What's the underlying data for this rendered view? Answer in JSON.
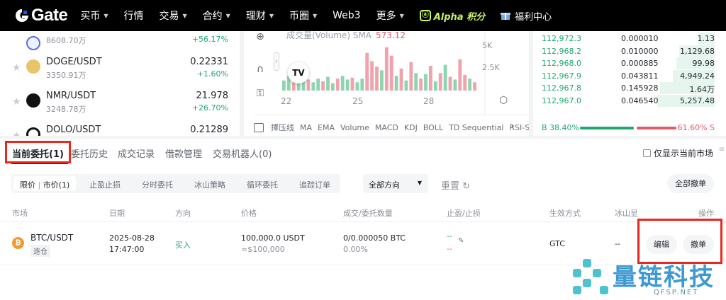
{
  "nav": {
    "logo_text": "Gate",
    "items": [
      {
        "label": "买币",
        "caret": true
      },
      {
        "label": "行情",
        "caret": false
      },
      {
        "label": "交易",
        "caret": true
      },
      {
        "label": "合约",
        "caret": true
      },
      {
        "label": "理财",
        "caret": true
      },
      {
        "label": "币圈",
        "caret": true
      },
      {
        "label": "Web3",
        "caret": false
      },
      {
        "label": "更多",
        "caret": true
      }
    ],
    "alpha_label": "Alpha 积分",
    "welfare_label": "福利中心"
  },
  "markets": [
    {
      "symbol": "",
      "volume": "8608.70万",
      "price": "",
      "change": "+56.17%"
    },
    {
      "symbol": "DOGE/USDT",
      "volume": "3350.91万",
      "price": "0.22331",
      "change": "+1.60%"
    },
    {
      "symbol": "NMR/USDT",
      "volume": "3248.78万",
      "price": "21.978",
      "change": "+26.70%"
    },
    {
      "symbol": "DOLO/USDT",
      "volume": "",
      "price": "0.21289",
      "change": ""
    }
  ],
  "chart": {
    "volume_label": "成交量(Volume) SMA",
    "volume_value": "573.12",
    "y_ticks": [
      "5K",
      "2.5K"
    ],
    "x_ticks": [
      "22",
      "25",
      "28"
    ],
    "indicators": [
      "擇压线",
      "MA",
      "EMA",
      "Volume",
      "MACD",
      "KDJ",
      "BOLL",
      "TD Sequential",
      "RSI-S-I"
    ],
    "chart_data": {
      "type": "bar",
      "title": "",
      "series_name": "成交量(Volume)",
      "values": [
        1100,
        1600,
        900,
        1400,
        1700,
        1200,
        900,
        1300,
        1000,
        1500,
        800,
        1300,
        1600,
        1200,
        1400,
        900,
        1300,
        4100,
        3200,
        2600,
        2200,
        4700,
        3800,
        1600,
        2400,
        1100,
        3100,
        1900,
        1300,
        1800,
        2700,
        1000,
        1900,
        2800,
        1500,
        1200,
        3400,
        1700,
        1300,
        900
      ],
      "colors": [
        "green",
        "green",
        "red",
        "green",
        "green",
        "red",
        "green",
        "green",
        "red",
        "green",
        "green",
        "red",
        "green",
        "green",
        "red",
        "green",
        "green",
        "red",
        "red",
        "red",
        "green",
        "red",
        "red",
        "green",
        "red",
        "green",
        "red",
        "green",
        "red",
        "green",
        "red",
        "green",
        "red",
        "green",
        "red",
        "green",
        "red",
        "red",
        "green",
        "red"
      ],
      "ylim": [
        0,
        6000
      ],
      "sma_value": 573.12
    }
  },
  "orderbook": {
    "rows": [
      {
        "price": "112,972.3",
        "qty": "0.000010",
        "total": "1.13",
        "depth": 0.25
      },
      {
        "price": "112,968.2",
        "qty": "0.010000",
        "total": "1,129.68",
        "depth": 0.55
      },
      {
        "price": "112,968.0",
        "qty": "0.000885",
        "total": "99.98",
        "depth": 0.6
      },
      {
        "price": "112,967.9",
        "qty": "0.043811",
        "total": "4,949.24",
        "depth": 0.65
      },
      {
        "price": "112,967.8",
        "qty": "0.145928",
        "total": "1.64万",
        "depth": 0.85
      },
      {
        "price": "112,967.0",
        "qty": "0.046540",
        "total": "5,257.48",
        "depth": 0.9
      }
    ],
    "buy_ratio": "B 38.40%",
    "sell_ratio": "61.60% S"
  },
  "orders": {
    "tabs": [
      "当前委托(1)",
      "委托历史",
      "成交记录",
      "借款管理",
      "交易机器人(0)"
    ],
    "only_current_label": "仅显示当前市场",
    "sub_tabs": [
      "限价",
      "市价(1)",
      "止盈止损",
      "分时委托",
      "冰山策略",
      "循环委托",
      "追踪订单"
    ],
    "direction_label": "全部方向",
    "reset_label": "重置",
    "cancel_all_label": "全部撤单",
    "columns": [
      "市场",
      "日期",
      "方向",
      "价格",
      "成交/委托数量",
      "止盈/止损",
      "生效方式",
      "冰山显",
      "操作"
    ],
    "row": {
      "market": "BTC/USDT",
      "tag": "逐仓",
      "date": "2025-08-28",
      "time": "17:47:00",
      "side": "买入",
      "price": "100,000.0 USDT",
      "price_sub": "≈$100,000",
      "filled": "0/0.000050 BTC",
      "filled_pct": "0.00%",
      "tp": "--",
      "sl": "--",
      "tif": "GTC",
      "iceberg": "--",
      "edit_label": "编辑",
      "cancel_label": "撤单"
    }
  },
  "watermark": {
    "text": "量链科技",
    "sub": "QFSP.NET"
  }
}
